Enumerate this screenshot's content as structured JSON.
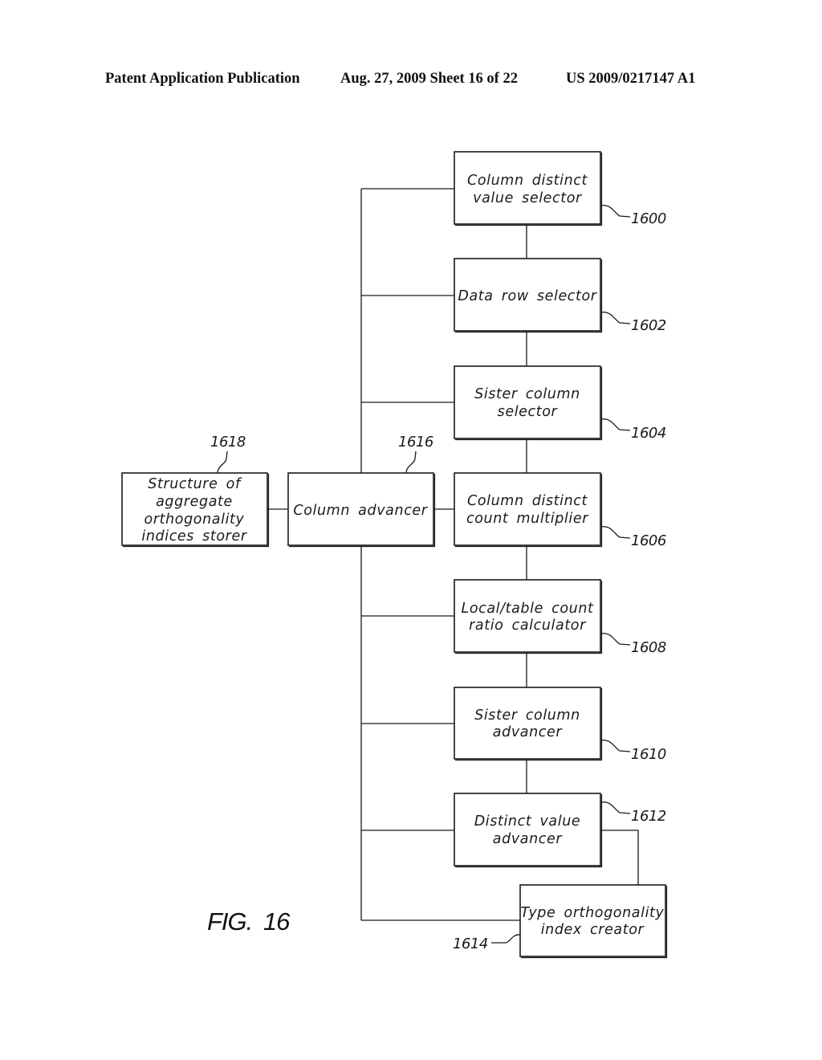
{
  "header": {
    "publication": "Patent Application Publication",
    "date_sheet": "Aug. 27, 2009  Sheet 16 of 22",
    "number": "US 2009/0217147 A1"
  },
  "figure": {
    "label": "FIG. 16"
  },
  "blocks": {
    "b1600": {
      "ref": "1600",
      "lines": [
        "Column distinct",
        "value selector"
      ]
    },
    "b1602": {
      "ref": "1602",
      "lines": [
        "Data row selector"
      ]
    },
    "b1604": {
      "ref": "1604",
      "lines": [
        "Sister column",
        "selector"
      ]
    },
    "b1606": {
      "ref": "1606",
      "lines": [
        "Column distinct",
        "count multiplier"
      ]
    },
    "b1608": {
      "ref": "1608",
      "lines": [
        "Local/table count",
        "ratio calculator"
      ]
    },
    "b1610": {
      "ref": "1610",
      "lines": [
        "Sister column",
        "advancer"
      ]
    },
    "b1612": {
      "ref": "1612",
      "lines": [
        "Distinct value",
        "advancer"
      ]
    },
    "b1614": {
      "ref": "1614",
      "lines": [
        "Type orthogonality",
        "index creator"
      ]
    },
    "b1616": {
      "ref": "1616",
      "lines": [
        "Column advancer"
      ]
    },
    "b1618": {
      "ref": "1618",
      "lines": [
        "Structure of",
        "aggregate",
        "orthogonality",
        "indices storer"
      ]
    }
  },
  "connections": [
    [
      "1600",
      "1602"
    ],
    [
      "1602",
      "1604"
    ],
    [
      "1604",
      "1606"
    ],
    [
      "1606",
      "1608"
    ],
    [
      "1608",
      "1610"
    ],
    [
      "1610",
      "1612"
    ],
    [
      "1612",
      "1614"
    ],
    [
      "1616",
      "1600"
    ],
    [
      "1616",
      "1602"
    ],
    [
      "1616",
      "1604"
    ],
    [
      "1616",
      "1606"
    ],
    [
      "1616",
      "1608"
    ],
    [
      "1616",
      "1610"
    ],
    [
      "1616",
      "1612"
    ],
    [
      "1616",
      "1614"
    ],
    [
      "1616",
      "1618"
    ]
  ]
}
